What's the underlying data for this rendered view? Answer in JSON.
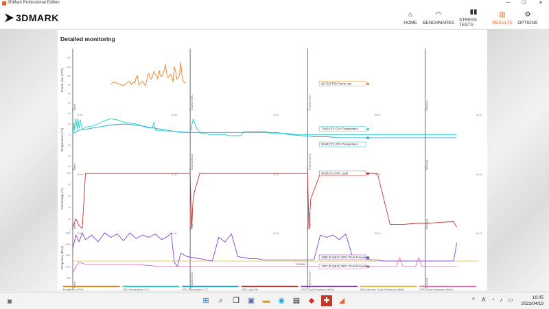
{
  "window": {
    "title": "3DMark Professional Edition"
  },
  "app": {
    "logo_text": "3DMARK"
  },
  "nav": [
    {
      "label": "HOME",
      "icon": "home-icon"
    },
    {
      "label": "BENCHMARKS",
      "icon": "gauge-icon"
    },
    {
      "label": "STRESS TESTS",
      "icon": "bar-chart-icon"
    },
    {
      "label": "RESULTS",
      "icon": "results-icon",
      "active": true
    },
    {
      "label": "OPTIONS",
      "icon": "gear-icon"
    }
  ],
  "section": {
    "title": "Detailed monitoring"
  },
  "chart_data": [
    {
      "type": "line",
      "ylabel": "Frame rate (FPS)",
      "yticks": [
        40,
        60,
        80,
        100,
        120,
        140
      ],
      "ylim": [
        20,
        160
      ],
      "segments": [
        "Demo",
        "Graphics test 1",
        "Graphics test 2",
        "CPU test"
      ],
      "xticks": [
        "00:00",
        "01:40",
        "03:20",
        "05:00",
        "06:40"
      ],
      "series": [
        {
          "color": "#f07d1b",
          "tooltip": "82.75 (FPS) Frame rate",
          "x": [
            0.6,
            0.62,
            0.66,
            0.7,
            0.74,
            0.77,
            0.8,
            0.82,
            0.85,
            0.88,
            0.9,
            0.92,
            0.94,
            0.96,
            0.98,
            1.0,
            1.02,
            1.04,
            1.06,
            1.08,
            1.1,
            1.12,
            1.14,
            1.16,
            1.18,
            1.2,
            1.22,
            1.24,
            1.26,
            1.28,
            1.3,
            1.32,
            1.34,
            1.36,
            1.38,
            1.4,
            1.42,
            1.44,
            1.46,
            1.48,
            1.5,
            1.52,
            1.54,
            1.56,
            1.58,
            1.6,
            1.62,
            1.64,
            1.66,
            1.68,
            1.7,
            1.72,
            1.74,
            1.76,
            1.78
          ],
          "y": [
            82,
            84,
            86,
            83,
            81,
            79,
            78,
            80,
            83,
            86,
            88,
            80,
            83,
            86,
            84,
            96,
            100,
            79,
            82,
            85,
            88,
            83,
            78,
            86,
            100,
            105,
            94,
            92,
            100,
            110,
            102,
            100,
            93,
            112,
            100,
            98,
            103,
            111,
            125,
            105,
            96,
            100,
            103,
            97,
            86,
            120,
            110,
            92,
            95,
            100,
            130,
            102,
            88,
            85,
            83
          ]
        }
      ]
    },
    {
      "type": "line",
      "ylabel": "Temperature (°C)",
      "yticks": [
        40,
        50,
        60,
        70,
        80,
        90
      ],
      "ylim": [
        35,
        95
      ],
      "segments": [
        "Demo",
        "Graphics test 1",
        "Graphics test 2",
        "CPU test"
      ],
      "xticks": [
        "00:00",
        "01:40",
        "03:20",
        "05:00",
        "06:40"
      ],
      "series": [
        {
          "name": "GPU Temperature",
          "color": "#1fd0c0",
          "tooltip": "74.99 (°C) GPU Temperature",
          "x": [
            0.0,
            0.02,
            0.03,
            0.05,
            0.07,
            0.08,
            0.1,
            0.12,
            0.15,
            0.2,
            0.3,
            0.4,
            0.5,
            0.6,
            0.7,
            0.8,
            0.9,
            1.0,
            1.05,
            1.1,
            1.15,
            1.2,
            1.22,
            1.25,
            1.28,
            1.3,
            1.4,
            1.5,
            1.6,
            1.7,
            1.8,
            1.85,
            1.9,
            1.95,
            2.0,
            2.05,
            2.1,
            2.15,
            2.2,
            2.25,
            2.3,
            2.35,
            2.4,
            2.45,
            2.5,
            2.55,
            2.6,
            2.65,
            2.7,
            2.75,
            2.8,
            2.85,
            2.9,
            2.95,
            3.0,
            3.05,
            3.1,
            3.2,
            3.3,
            3.4,
            3.5,
            3.6,
            3.7,
            3.8,
            3.9,
            4.0,
            4.1,
            4.2,
            4.25,
            4.3,
            4.4,
            4.5,
            4.6,
            4.7,
            4.8,
            4.9,
            5.0,
            5.1,
            5.2,
            5.3,
            5.4,
            5.5,
            5.6,
            5.7,
            5.8,
            5.9,
            6.0,
            6.05
          ],
          "y": [
            70,
            81,
            74,
            85,
            75,
            85,
            76,
            84,
            75,
            77,
            78,
            80,
            83,
            85,
            84,
            82,
            81,
            80,
            79,
            78,
            77,
            76,
            77,
            76,
            82,
            74,
            74,
            73,
            73,
            72,
            72,
            72,
            85,
            76,
            72,
            71,
            71,
            70,
            70,
            70,
            70,
            70,
            70,
            69,
            69,
            69,
            69,
            69,
            73,
            73,
            73,
            73,
            73,
            73,
            73,
            73,
            71,
            71,
            71,
            71,
            70,
            70,
            70,
            70,
            70,
            70,
            70,
            70,
            70,
            70,
            70,
            70,
            70,
            70,
            70,
            70,
            70,
            70,
            70,
            70,
            70,
            70,
            70,
            70,
            70,
            70,
            70,
            70
          ]
        },
        {
          "name": "GPU Temperature",
          "color": "#1aa6e0",
          "tooltip": "66.88 (°C) GPU Temperature",
          "x": [
            0.0,
            0.1,
            0.2,
            0.4,
            0.6,
            0.8,
            1.0,
            1.2,
            1.4,
            1.6,
            1.8,
            2.0,
            2.2,
            2.4,
            2.6,
            2.8,
            3.0,
            3.2,
            3.4,
            3.6,
            3.8,
            4.0,
            4.2,
            4.4,
            4.6,
            4.8,
            5.0,
            5.2,
            5.4,
            5.6,
            5.8,
            6.0,
            6.05
          ],
          "y": [
            71,
            74,
            75,
            77,
            79,
            80,
            79,
            77,
            75,
            73,
            72,
            72,
            72,
            72,
            72,
            72,
            72,
            72,
            70,
            69,
            68,
            68,
            67,
            67,
            67,
            67,
            67,
            67,
            67,
            67,
            67,
            67,
            67
          ]
        }
      ]
    },
    {
      "type": "line",
      "ylabel": "Percentage (%)",
      "yticks": [
        0,
        20,
        40,
        60,
        80,
        100
      ],
      "ylim": [
        0,
        110
      ],
      "segments": [
        "Demo",
        "Graphics test 1",
        "Graphics test 2",
        "CPU test"
      ],
      "xticks": [
        "00:00",
        "01:40",
        "03:20",
        "05:00",
        "06:40"
      ],
      "series": [
        {
          "name": "GPU Load",
          "color": "#d42a2a",
          "tooltip": "98.85 (%) GPU Load",
          "x": [
            0.0,
            0.05,
            0.1,
            0.15,
            0.2,
            0.25,
            1.5,
            1.85,
            1.87,
            1.9,
            2.0,
            2.05,
            2.1,
            2.15,
            2.2,
            2.25,
            3.5,
            3.7,
            3.72,
            3.75,
            3.9,
            3.95,
            4.0,
            4.05,
            4.1,
            4.2,
            4.4,
            4.6,
            4.8,
            5.0,
            5.2,
            5.4,
            5.6,
            5.8,
            6.0,
            6.05
          ],
          "y": [
            5,
            20,
            8,
            3,
            99,
            99,
            99,
            99,
            2,
            60,
            99,
            99,
            99,
            99,
            99,
            99,
            99,
            99,
            2,
            55,
            99,
            99,
            99,
            99,
            99,
            99,
            99,
            99,
            99,
            10,
            10,
            12,
            12,
            14,
            15,
            5
          ]
        }
      ]
    },
    {
      "type": "line",
      "ylabel": "Frequency (MHz)",
      "yticks": [
        0,
        500,
        1000,
        1500,
        2000,
        2500
      ],
      "ylim": [
        0,
        2800
      ],
      "segments": [
        "Demo",
        "Graphics test 1",
        "Graphics test 2",
        "CPU test"
      ],
      "xticks": [
        "00:00",
        "01:40",
        "03:20",
        "05:00",
        "06:40"
      ],
      "reference": {
        "value": 1246,
        "label": "2126.8"
      },
      "series": [
        {
          "name": "GPU Clock Frequency",
          "color": "#8a3bd1",
          "tooltip": "1996.32 (MHz) GPU Clock Frequency",
          "x": [
            0.0,
            0.05,
            0.1,
            0.15,
            0.2,
            0.3,
            0.4,
            0.5,
            0.6,
            0.7,
            0.8,
            0.9,
            1.0,
            1.1,
            1.2,
            1.3,
            1.4,
            1.5,
            1.55,
            1.6,
            1.65,
            1.7,
            1.8,
            1.9,
            2.0,
            2.1,
            2.2,
            2.3,
            2.4,
            2.5,
            2.6,
            2.7,
            2.8,
            2.9,
            3.0,
            3.1,
            3.2,
            3.3,
            3.4,
            3.5,
            3.6,
            3.7,
            3.8,
            3.9,
            4.0,
            4.1,
            4.2,
            4.3,
            4.4,
            4.5,
            4.6,
            4.7,
            4.8,
            4.9,
            5.0,
            5.1,
            5.2,
            5.3,
            5.4,
            5.5,
            5.6,
            5.7,
            5.8,
            5.9,
            6.0,
            6.05
          ],
          "y": [
            1800,
            2400,
            2100,
            2500,
            2200,
            2400,
            2100,
            2500,
            2300,
            2450,
            2150,
            2500,
            2250,
            2400,
            2300,
            2450,
            2200,
            2350,
            2500,
            1200,
            1000,
            1600,
            1450,
            1400,
            1350,
            1300,
            1250,
            2300,
            2100,
            2450,
            1450,
            1400,
            1350,
            1350,
            1300,
            1300,
            1300,
            1300,
            1300,
            1300,
            1300,
            1300,
            1300,
            2400,
            2300,
            2400,
            2200,
            2450,
            1500,
            1400,
            1350,
            1300,
            1300,
            1250,
            1250,
            1250,
            1250,
            1250,
            1250,
            1250,
            1250,
            1250,
            1250,
            1250,
            1250,
            2050
          ]
        },
        {
          "name": "GPU Memory Clock Frequency",
          "color": "#f06ab4",
          "tooltip": "1097.32 (MHz) GPU Clock Frequency",
          "x": [
            0.0,
            0.05,
            0.1,
            0.15,
            0.2,
            0.4,
            0.6,
            0.8,
            1.0,
            1.2,
            1.4,
            1.6,
            1.8,
            2.0,
            2.2,
            2.4,
            2.6,
            2.8,
            3.0,
            3.2,
            3.4,
            3.6,
            3.8,
            4.0,
            4.2,
            4.4,
            4.6,
            4.8,
            5.0,
            5.1,
            5.15,
            5.2,
            5.4,
            5.45,
            5.5,
            5.6,
            5.8,
            6.0,
            6.05
          ],
          "y": [
            700,
            1000,
            1200,
            1150,
            1100,
            1100,
            1100,
            1100,
            1100,
            1050,
            1000,
            1000,
            1000,
            1000,
            1000,
            1000,
            1000,
            1000,
            1000,
            1000,
            1000,
            1000,
            1000,
            1000,
            1000,
            1000,
            1000,
            1000,
            1000,
            1000,
            1400,
            1000,
            1000,
            1400,
            1000,
            1000,
            1000,
            1000,
            1000
          ]
        }
      ]
    }
  ],
  "legend": [
    {
      "label": "Frame rate (FPS)",
      "color": "#f07d1b"
    },
    {
      "label": "CPU Temperature (°C)",
      "color": "#1fd0c0"
    },
    {
      "label": "GPU Temperature (°C)",
      "color": "#1aa6e0"
    },
    {
      "label": "GPU Load (%)",
      "color": "#d42a2a"
    },
    {
      "label": "CPU Clock Frequency (MHz)",
      "color": "#8a3bd1"
    },
    {
      "label": "GPU Memory Clock Frequency (MHz)",
      "color": "#f0b040"
    },
    {
      "label": "GPU Clock Frequency (MHz)",
      "color": "#f06ab4"
    }
  ],
  "taskbar": {
    "time": "16:05",
    "date": "2022/04/19",
    "lang": "A",
    "icons": [
      "windows-start-icon",
      "search-icon",
      "task-view-icon",
      "chat-icon",
      "file-explorer-icon",
      "edge-icon",
      "store-icon",
      "app-red-icon",
      "app-3dmark-icon"
    ]
  }
}
